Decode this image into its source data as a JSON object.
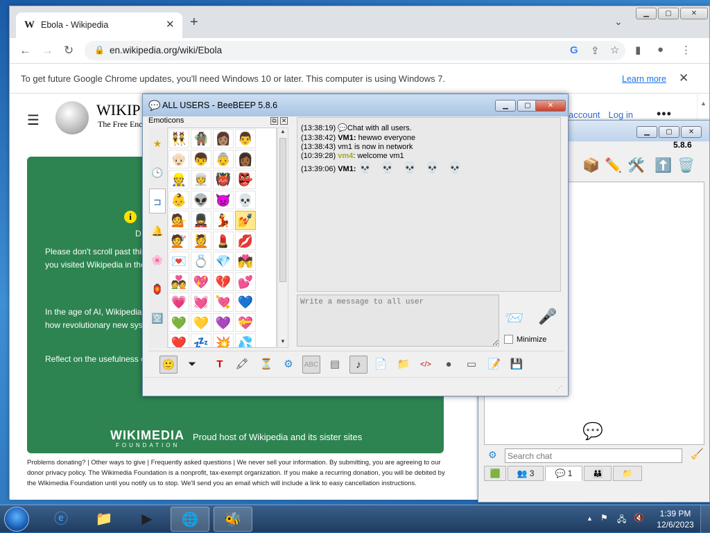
{
  "browser": {
    "tab_title": "Ebola - Wikipedia",
    "tab_favicon": "W",
    "url": "en.wikipedia.org/wiki/Ebola",
    "infobar_message": "To get future Google Chrome updates, you'll need Windows 10 or later. This computer is using Windows 7.",
    "infobar_link": "Learn more"
  },
  "wiki": {
    "name": "WIKIP",
    "tagline": "The Free Enc",
    "nav": [
      "account",
      "Log in"
    ],
    "banner": {
      "title": "Wi",
      "subtitle": "D",
      "p1": "Please don't scroll past this will soon be too late to help you visited Wikipedia in the If everyone reading this righ",
      "p2": "In the age of AI, Wikipedia for emerging technologies. how revolutionary new syst",
      "p3": "Reflect on the usefulness of please give $2.75. Every co",
      "foot_name": "WIKIMEDIA",
      "foot_sub": "FOUNDATION",
      "proud": "Proud host of Wikipedia and its sister sites"
    },
    "footer": "Problems donating? | Other ways to give | Frequently asked questions | We never sell your information. By submitting, you are agreeing to our donor privacy policy. The Wikimedia Foundation is a nonprofit, tax-exempt organization. If you make a recurring donation, you will be debited by the Wikimedia Foundation until you notify us to stop. We'll send you an email which will include a link to easy cancellation instructions."
  },
  "beebeep": {
    "title": "ALL USERS - BeeBEEP 5.8.6",
    "emoticons_label": "Emoticons",
    "emoticons": [
      "👯",
      "🧌",
      "👩🏽",
      "👨",
      "👴🏻",
      "👦",
      "👵",
      "👩🏾",
      "👷",
      "👳",
      "👹",
      "👺",
      "👶",
      "👽",
      "👿",
      "💀",
      "💁",
      "💂",
      "💃",
      "💅",
      "💇",
      "💆",
      "💄",
      "💋",
      "💌",
      "💍",
      "💎",
      "💏",
      "💑",
      "💖",
      "💔",
      "💕",
      "💗",
      "💓",
      "💘",
      "💙",
      "💚",
      "💛",
      "💜",
      "💝",
      "❤️",
      "💤",
      "💥",
      "💦",
      "💧",
      "💨",
      "💩",
      "💪",
      "💫",
      "💬",
      "🔥",
      "👥",
      "👬",
      "👫",
      "💭"
    ],
    "chat_lines": [
      {
        "time": "(13:38:19)",
        "user": "",
        "text": "Chat with all users."
      },
      {
        "time": "(13:38:42)",
        "user": "VM1:",
        "text": "hewwo everyone"
      },
      {
        "time": "(13:38:43)",
        "user": "",
        "text": "vm1 is now in network"
      },
      {
        "time": "(10:39:28)",
        "user": "vm4",
        "text": ": welcome vm1"
      },
      {
        "time": "(13:39:06)",
        "user": "VM1:",
        "text": "💀 💀 💀 💀 💀"
      }
    ],
    "input_placeholder": "Write a message to all user",
    "minimize_label": "Minimize"
  },
  "side": {
    "version": "5.8.6",
    "search_placeholder": "Search chat",
    "tab_users_count": "3",
    "tab_chats_count": "1"
  },
  "taskbar": {
    "time": "1:39 PM",
    "date": "12/6/2023"
  }
}
